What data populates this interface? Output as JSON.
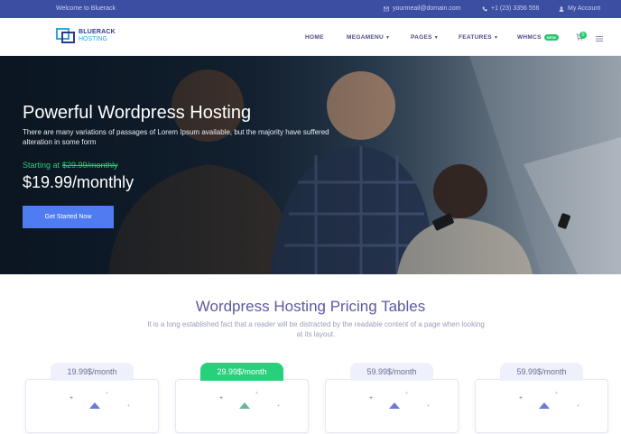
{
  "topbar": {
    "welcome": "Welcome to Bluerack",
    "email": "yourmeail@domain.com",
    "phone": "+1 (23) 3356 556",
    "account": "My Account"
  },
  "logo": {
    "line1": "BLUERACK",
    "line2": "HOSTING"
  },
  "nav": {
    "items": [
      {
        "label": "HOME",
        "dropdown": false
      },
      {
        "label": "MEGAMENU",
        "dropdown": true
      },
      {
        "label": "PAGES",
        "dropdown": true
      },
      {
        "label": "FEATURES",
        "dropdown": true
      },
      {
        "label": "WHMCS",
        "dropdown": false,
        "badge": "NEW"
      }
    ],
    "cart_count": "0"
  },
  "hero": {
    "title": "Powerful Wordpress Hosting",
    "description": "There are many variations of passages of Lorem Ipsum available, but the majority have suffered alteration in some form",
    "starting_label": "Starting at",
    "old_price": "$29.99/monthly",
    "price": "$19.99/monthly",
    "cta": "Get Started Now"
  },
  "pricing": {
    "title": "Wordpress Hosting Pricing Tables",
    "subtitle": "It is a long established fact that a reader will be distracted by the readable content of a page when looking at its layout.",
    "plans": [
      {
        "price": "19.99$/month",
        "featured": false
      },
      {
        "price": "29.99$/month",
        "featured": true
      },
      {
        "price": "59.99$/month",
        "featured": false
      },
      {
        "price": "59.99$/month",
        "featured": false
      }
    ]
  },
  "colors": {
    "topbar": "#3b4ea1",
    "accent_green": "#27d07a",
    "cta_blue": "#4f7cf0",
    "heading_purple": "#5a5aa0"
  }
}
